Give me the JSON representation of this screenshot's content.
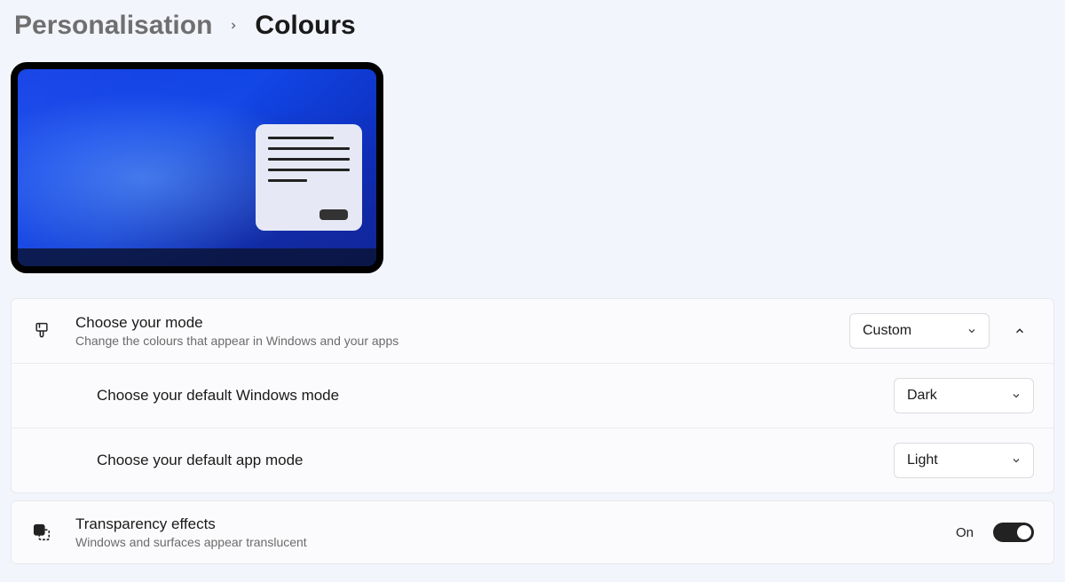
{
  "breadcrumb": {
    "parent": "Personalisation",
    "current": "Colours"
  },
  "mode": {
    "title": "Choose your mode",
    "subtitle": "Change the colours that appear in Windows and your apps",
    "value": "Custom"
  },
  "windows_mode": {
    "title": "Choose your default Windows mode",
    "value": "Dark"
  },
  "app_mode": {
    "title": "Choose your default app mode",
    "value": "Light"
  },
  "transparency": {
    "title": "Transparency effects",
    "subtitle": "Windows and surfaces appear translucent",
    "state_label": "On"
  }
}
